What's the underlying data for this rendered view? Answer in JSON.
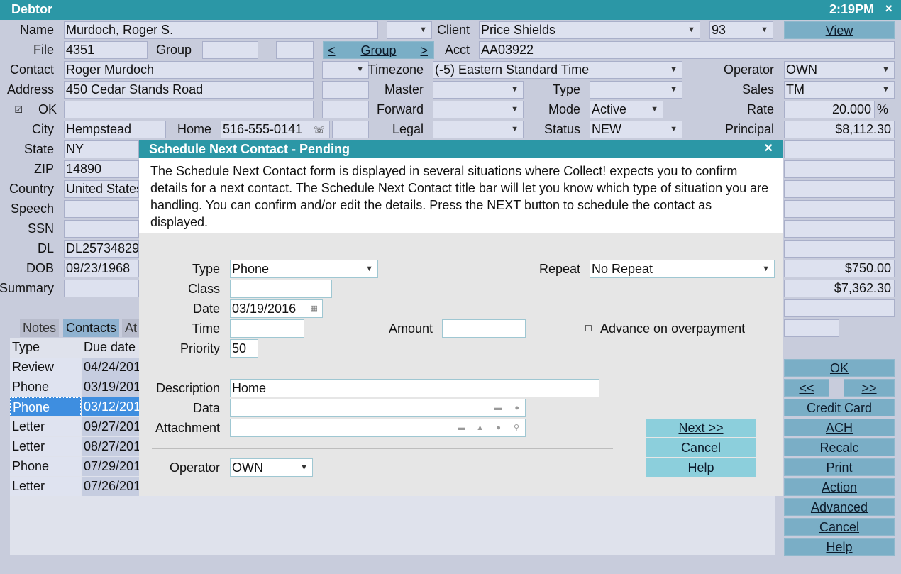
{
  "window": {
    "title": "Debtor",
    "clock": "2:19PM",
    "close": "×"
  },
  "labels": {
    "name": "Name",
    "file": "File",
    "group": "Group",
    "contact": "Contact",
    "address": "Address",
    "ok": "OK",
    "city": "City",
    "home": "Home",
    "state": "State",
    "zip": "ZIP",
    "country": "Country",
    "speech": "Speech",
    "ssn": "SSN",
    "dl": "DL",
    "dob": "DOB",
    "summary": "Summary",
    "client": "Client",
    "acct": "Acct",
    "timezone": "Timezone",
    "master": "Master",
    "forward": "Forward",
    "legal": "Legal",
    "type": "Type",
    "mode": "Mode",
    "status": "Status",
    "operator": "Operator",
    "sales": "Sales",
    "rate": "Rate",
    "principal": "Principal",
    "group_nav": "Group"
  },
  "fields": {
    "name": "Murdoch, Roger S.",
    "file": "4351",
    "contact": "Roger Murdoch",
    "address": "450 Cedar Stands Road",
    "city": "Hempstead",
    "home": "516-555-0141",
    "state": "NY",
    "zip": "14890",
    "country": "United States",
    "dl": "DL25734829",
    "dob": "09/23/1968",
    "client": "Price Shields",
    "client_no": "93",
    "acct": "AA03922",
    "timezone": "(-5) Eastern Standard Time",
    "mode": "Active",
    "status": "NEW",
    "operator": "OWN",
    "sales": "TM",
    "rate": "20.000",
    "rate_unit": "%",
    "principal": "$8,112.30",
    "amount1": "$750.00",
    "amount2": "$7,362.30"
  },
  "buttons": {
    "view": "View",
    "group_prev": "<",
    "group_next": ">",
    "ok": "OK",
    "prev": "<<",
    "next": ">>",
    "credit_card": "Credit Card",
    "ach": "ACH",
    "recalc": "Recalc",
    "print": "Print",
    "action": "Action",
    "advanced": "Advanced",
    "cancel": "Cancel",
    "help": "Help"
  },
  "tabs": [
    "Notes",
    "Contacts",
    "At"
  ],
  "list": {
    "headers": [
      "Type",
      "Due date"
    ],
    "rows": [
      [
        "Review",
        "04/24/201"
      ],
      [
        "Phone",
        "03/19/201"
      ],
      [
        "Phone",
        "03/12/201"
      ],
      [
        "Letter",
        "09/27/201"
      ],
      [
        "Letter",
        "08/27/201"
      ],
      [
        "Phone",
        "07/29/201"
      ],
      [
        "Letter",
        "07/26/201"
      ]
    ]
  },
  "dialog": {
    "title": "Schedule Next Contact - Pending",
    "description": "The Schedule Next Contact form is displayed in several situations where Collect! expects you to confirm details for a next contact. The Schedule Next Contact title bar will let you know which type of situation you are handling. You can confirm and/or edit the details. Press the NEXT button to schedule the contact as displayed.",
    "labels": {
      "type": "Type",
      "class": "Class",
      "date": "Date",
      "time": "Time",
      "priority": "Priority",
      "amount": "Amount",
      "repeat": "Repeat",
      "advance": "Advance on overpayment",
      "description": "Description",
      "data": "Data",
      "attachment": "Attachment",
      "operator": "Operator"
    },
    "values": {
      "type": "Phone",
      "class": "",
      "date": "03/19/2016",
      "time": "",
      "priority": "50",
      "amount": "",
      "repeat": "No Repeat",
      "description": "Home",
      "data": "",
      "attachment": "",
      "operator": "OWN"
    },
    "buttons": {
      "next": "Next >>",
      "cancel": "Cancel",
      "help": "Help"
    }
  }
}
